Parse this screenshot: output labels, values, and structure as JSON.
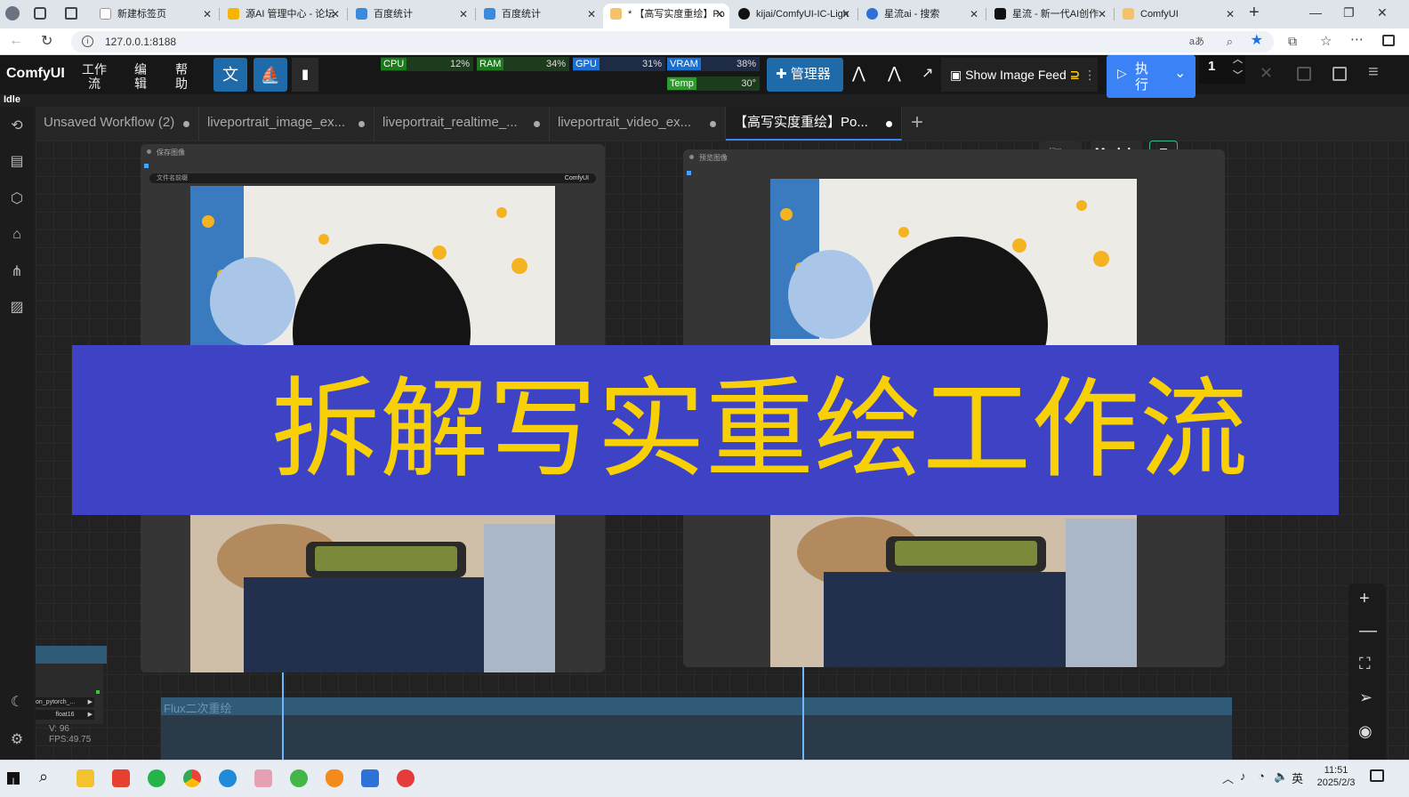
{
  "browser": {
    "tabs": [
      {
        "label": "新建标签页",
        "active": false
      },
      {
        "label": "源AI 管理中心 - 论坛",
        "active": false
      },
      {
        "label": "百度统计",
        "active": false
      },
      {
        "label": "百度统计",
        "active": false
      },
      {
        "label": "* 【高写实度重绘】Po",
        "active": true
      },
      {
        "label": "kijai/ComfyUI-IC-Ligh",
        "active": false
      },
      {
        "label": "星流ai - 搜索",
        "active": false
      },
      {
        "label": "星流 - 新一代AI创作",
        "active": false
      },
      {
        "label": "ComfyUI",
        "active": false
      }
    ],
    "url": "127.0.0.1:8188"
  },
  "topbar": {
    "logo": "ComfyUI",
    "menu": [
      {
        "line1": "工作",
        "line2": "流"
      },
      {
        "line1": "编",
        "line2": "辑"
      },
      {
        "line1": "帮",
        "line2": "助"
      }
    ],
    "monitor": {
      "cpu_label": "CPU",
      "cpu": "12%",
      "ram_label": "RAM",
      "ram": "34%",
      "gpu_label": "GPU",
      "gpu": "31%",
      "vram_label": "VRAM",
      "vram": "38%",
      "temp_label": "Temp",
      "temp": "30°"
    },
    "manager_label": "管理器",
    "image_feed_label": "Show Image Feed",
    "run_label_line1": "执",
    "run_label_line2": "行",
    "queue_count": "1"
  },
  "status": "Idle",
  "workflow_tabs": [
    {
      "label": "Unsaved Workflow (2)",
      "active": false
    },
    {
      "label": "liveportrait_image_ex...",
      "active": false
    },
    {
      "label": "liveportrait_realtime_...",
      "active": false
    },
    {
      "label": "liveportrait_video_ex...",
      "active": false
    },
    {
      "label": "【高写实度重绘】Po...",
      "active": true
    }
  ],
  "canvas": {
    "models_label": "Models",
    "node_left_title": "保存图像",
    "node_left_field_label": "文件名前缀",
    "node_left_field_value": "ComfyUI",
    "node_right_title": "预览图像",
    "group_title": "Flux二次重绘",
    "mini_node_row1": "on_pytorch_...",
    "mini_node_row2": "float16",
    "fps_line1": "V: 96",
    "fps_line2": "FPS:49.75"
  },
  "banner": {
    "text": "拆解写实重绘工作流"
  },
  "taskbar": {
    "time": "11:51",
    "date": "2025/2/3",
    "ime": "英"
  },
  "colors": {
    "banner_bg": "#3d43c4",
    "banner_text": "#f8d007",
    "accent_blue": "#1f6aa8"
  }
}
